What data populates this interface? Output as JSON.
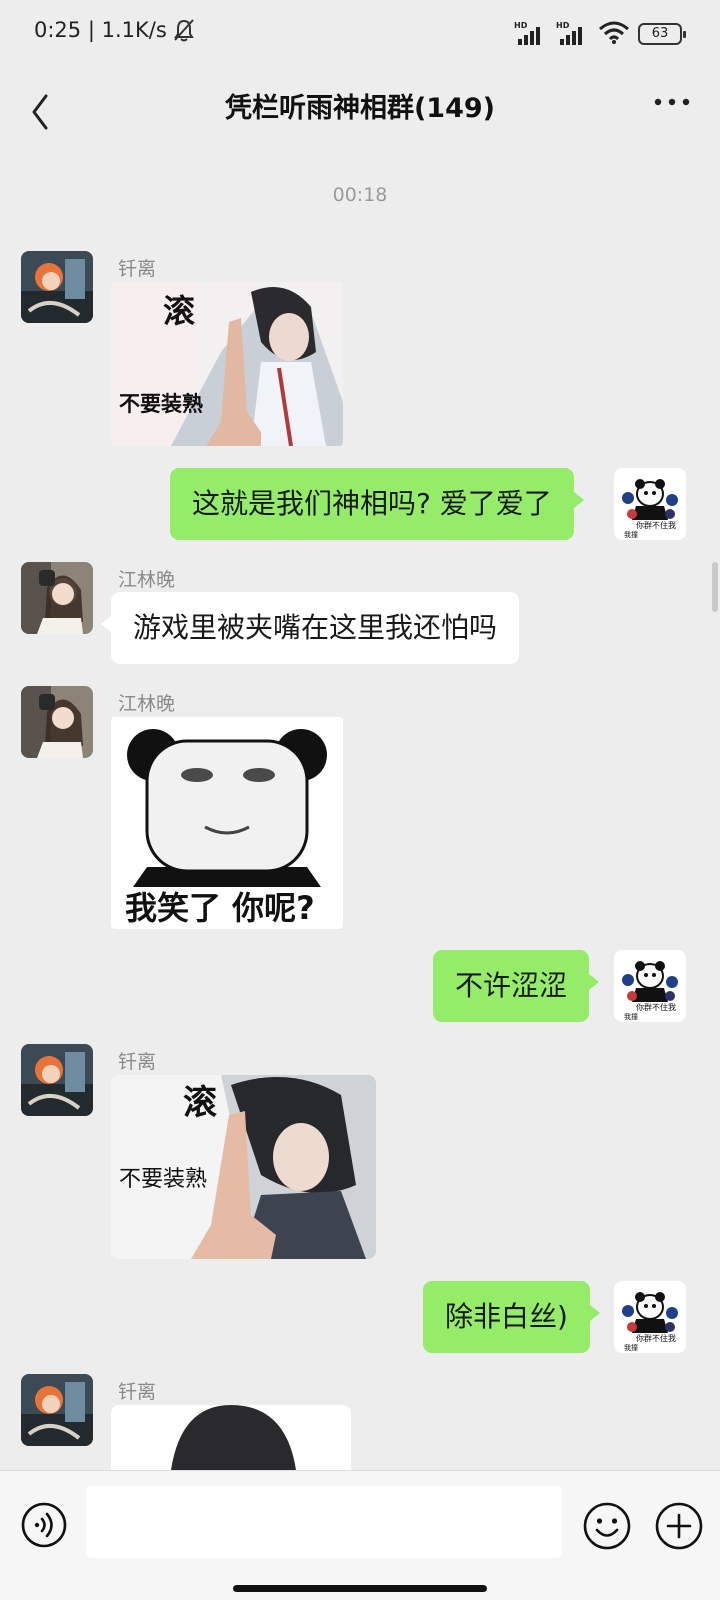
{
  "status_bar": {
    "time_speed": "0:25 | 1.1K/s",
    "network_1": "HD",
    "network_2": "HD",
    "battery": "63"
  },
  "header": {
    "title": "凭栏听雨神相群(149)",
    "back_icon": "chevron-left-icon",
    "more_icon": "more-dots-icon"
  },
  "timestamp": "00:18",
  "messages": [
    {
      "sender": "钎离",
      "type": "sticker",
      "caption_top": "滚",
      "caption_bottom": "不要装熟"
    },
    {
      "type": "text",
      "direction": "out",
      "text": "这就是我们神相吗? 爱了爱了"
    },
    {
      "sender": "江林晚",
      "type": "text",
      "text": "游戏里被夹嘴在这里我还怕吗"
    },
    {
      "sender": "江林晚",
      "type": "sticker",
      "caption_bottom": "我笑了 你呢?"
    },
    {
      "type": "text",
      "direction": "out",
      "text": "不许涩涩"
    },
    {
      "sender": "钎离",
      "type": "sticker",
      "caption_top": "滚",
      "caption_bottom": "不要装熟"
    },
    {
      "type": "text",
      "direction": "out",
      "text": "除非白丝)"
    },
    {
      "sender": "钎离",
      "type": "sticker"
    }
  ],
  "own_avatar": {
    "caption_1": "你群不住我",
    "caption_2": "我撞"
  },
  "input_bar": {
    "placeholder": "",
    "voice_icon": "voice-icon",
    "emoji_icon": "emoji-icon",
    "plus_icon": "plus-circle-icon"
  },
  "colors": {
    "background": "#ededed",
    "outgoing_bubble": "#95ec69",
    "incoming_bubble": "#ffffff"
  }
}
